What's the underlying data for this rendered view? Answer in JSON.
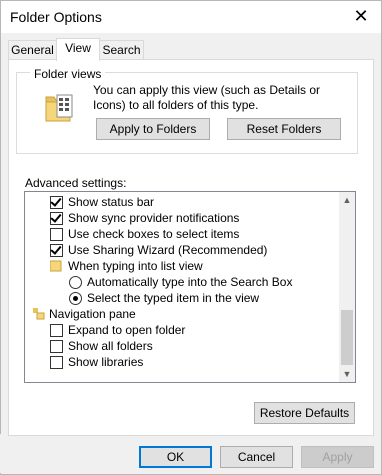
{
  "window": {
    "title": "Folder Options",
    "close_glyph": "✕"
  },
  "tabs": [
    {
      "label": "General"
    },
    {
      "label": "View"
    },
    {
      "label": "Search"
    }
  ],
  "folder_views": {
    "label": "Folder views",
    "description": "You can apply this view (such as Details or Icons) to all folders of this type.",
    "apply_button": "Apply to Folders",
    "reset_button": "Reset Folders"
  },
  "advanced": {
    "label": "Advanced settings:",
    "items": [
      {
        "kind": "checkbox",
        "checked": true,
        "label": "Show status bar"
      },
      {
        "kind": "checkbox",
        "checked": true,
        "label": "Show sync provider notifications"
      },
      {
        "kind": "checkbox",
        "checked": false,
        "label": "Use check boxes to select items"
      },
      {
        "kind": "checkbox",
        "checked": true,
        "label": "Use Sharing Wizard (Recommended)"
      },
      {
        "kind": "folder",
        "label": "When typing into list view"
      },
      {
        "kind": "radio",
        "checked": false,
        "label": "Automatically type into the Search Box"
      },
      {
        "kind": "radio",
        "checked": true,
        "label": "Select the typed item in the view"
      },
      {
        "kind": "nav",
        "label": "Navigation pane"
      },
      {
        "kind": "checkbox",
        "checked": false,
        "label": "Expand to open folder"
      },
      {
        "kind": "checkbox",
        "checked": false,
        "label": "Show all folders"
      },
      {
        "kind": "checkbox",
        "checked": false,
        "label": "Show libraries"
      }
    ]
  },
  "restore_button": "Restore Defaults",
  "footer": {
    "ok": "OK",
    "cancel": "Cancel",
    "apply": "Apply"
  }
}
